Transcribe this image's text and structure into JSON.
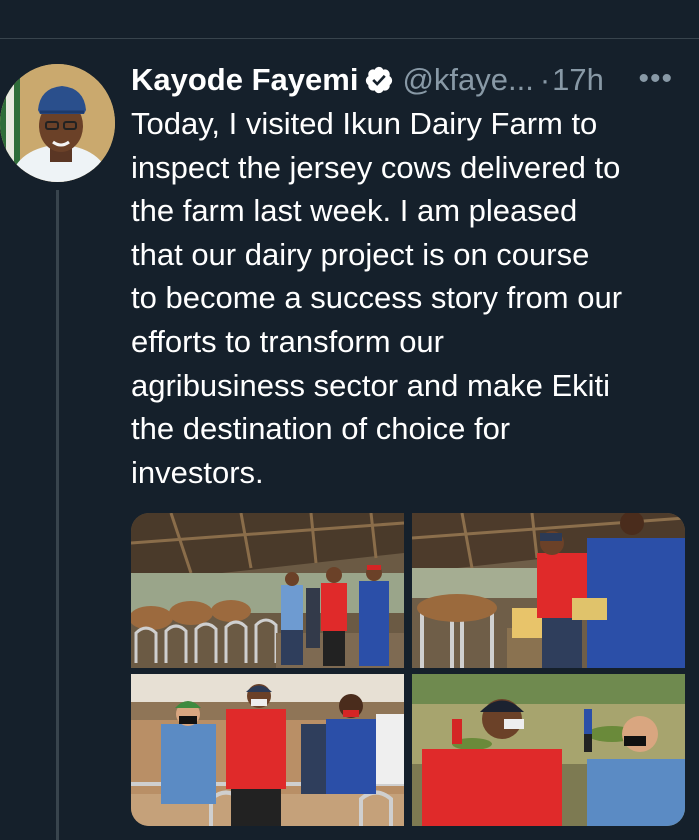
{
  "tweet": {
    "author_name": "Kayode Fayemi",
    "handle": "@kfaye...",
    "separator": "·",
    "time": "17h",
    "more": "•••",
    "text": "Today, I visited Ikun Dairy Farm to\ninspect the jersey cows delivered to\nthe farm last week. I am pleased\nthat our dairy project is on course\nto become a success story from our\nefforts to transform our\nagribusiness sector and make Ekiti\nthe destination of choice for\ninvestors."
  },
  "icons": {
    "verified": "verified-badge-icon",
    "more": "more-horizontal-icon"
  },
  "colors": {
    "background": "#15202b",
    "secondary_text": "#8899a6",
    "divider": "#38444d"
  }
}
